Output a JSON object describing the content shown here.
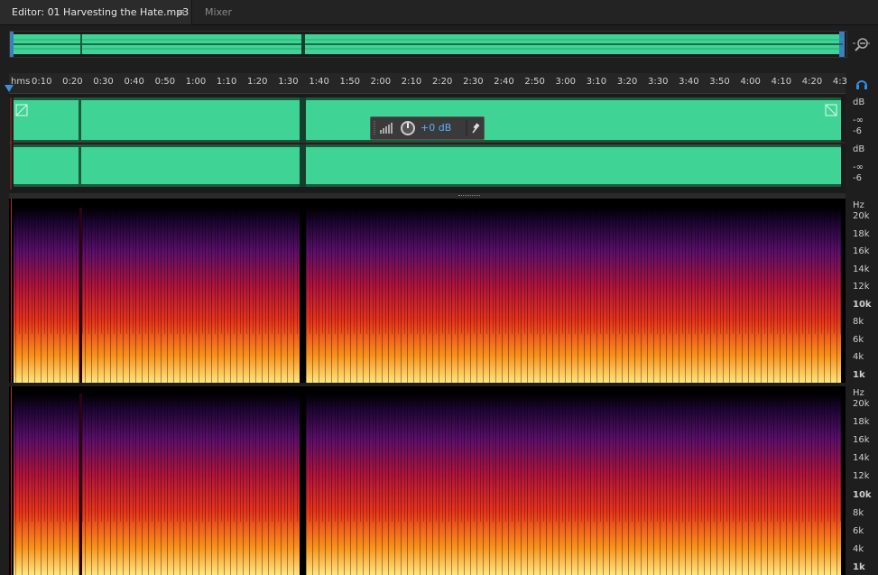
{
  "tabs": {
    "editor": "Editor: 01 Harvesting the Hate.mp3",
    "menu_glyph": "≡",
    "mixer": "Mixer"
  },
  "ruler": {
    "unit": "hms",
    "ticks": [
      "0:10",
      "0:20",
      "0:30",
      "0:40",
      "0:50",
      "1:00",
      "1:10",
      "1:20",
      "1:30",
      "1:40",
      "1:50",
      "2:00",
      "2:10",
      "2:20",
      "2:30",
      "2:40",
      "2:50",
      "3:00",
      "3:10",
      "3:20",
      "3:30",
      "3:40",
      "3:50",
      "4:00",
      "4:10",
      "4:20",
      "4:3"
    ]
  },
  "waveform": {
    "color": "#3fd495",
    "channels": [
      {
        "unit": "dB",
        "labels": [
          "-∞",
          "-6"
        ]
      },
      {
        "unit": "dB",
        "labels": [
          "-∞",
          "-6"
        ]
      }
    ]
  },
  "hud": {
    "gain": "+0 dB"
  },
  "spectral": {
    "unit": "Hz",
    "labels": [
      "20k",
      "18k",
      "16k",
      "14k",
      "12k",
      "10k",
      "8k",
      "6k",
      "4k",
      "1k"
    ]
  },
  "icons": {
    "zoom": "zoom-out-icon",
    "headphones": "headphones-icon",
    "pin": "pin-icon",
    "knob": "knob-icon",
    "meter": "level-meter-icon"
  }
}
